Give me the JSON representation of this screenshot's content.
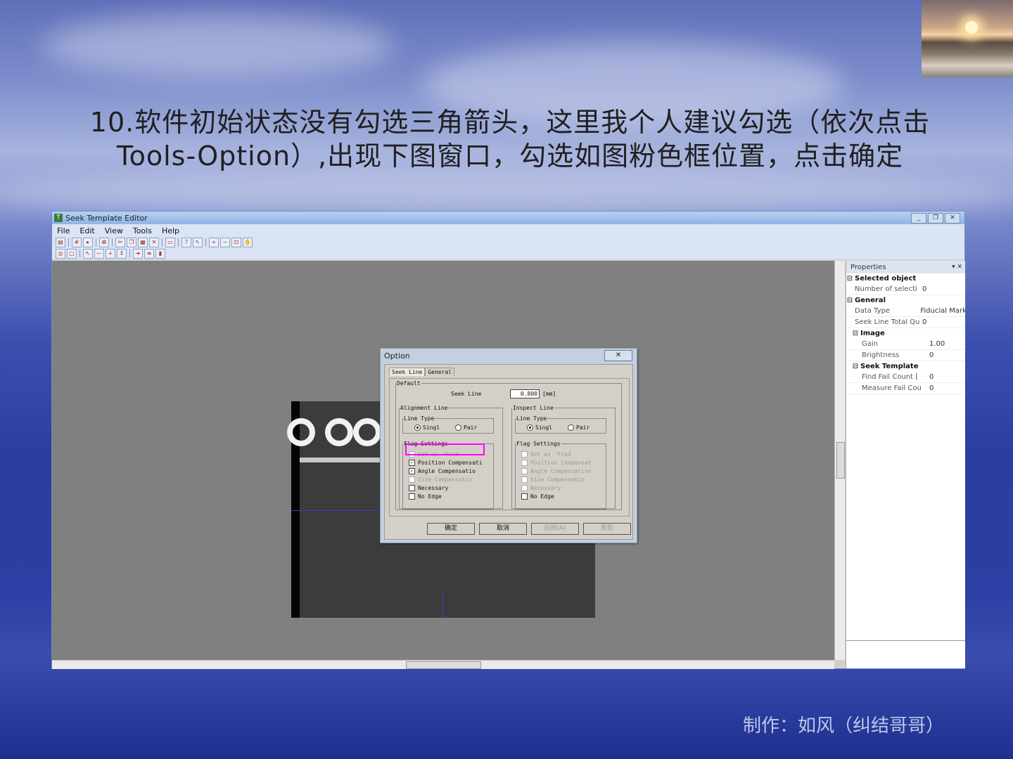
{
  "slide": {
    "title_line1": "10.软件初始状态没有勾选三角箭头，这里我个人建议勾选（依次点击",
    "title_line2": "Tools-Option）,出现下图窗口，勾选如图粉色框位置，点击确定",
    "credit": "制作：如风（纠结哥哥）"
  },
  "app": {
    "window_title": "Seek Template Editor",
    "menu": [
      "File",
      "Edit",
      "View",
      "Tools",
      "Help"
    ],
    "win_buttons": [
      "_",
      "❐",
      "✕"
    ]
  },
  "properties": {
    "header": "Properties",
    "pin": "▾ ✕",
    "categories": [
      {
        "name": "Selected object",
        "rows": [
          {
            "k": "Number of selecti",
            "v": "0"
          }
        ]
      },
      {
        "name": "General",
        "rows": [
          {
            "k": "Data Type",
            "v": "Fiducial Mark"
          },
          {
            "k": "Seek Line Total Qu",
            "v": "0"
          }
        ]
      },
      {
        "name": "Image",
        "rows": [
          {
            "k": "Gain",
            "v": "1.00"
          },
          {
            "k": "Brightness",
            "v": "0"
          }
        ]
      },
      {
        "name": "Seek Template",
        "rows": [
          {
            "k": "Find Fail Count [",
            "v": "0"
          },
          {
            "k": "Measure Fail Cou",
            "v": "0"
          }
        ]
      }
    ]
  },
  "dialog": {
    "title": "Option",
    "close": "✕",
    "tabs": [
      "Seek Line",
      "General"
    ],
    "default_group": "Default",
    "seek_line_label": "Seek Line",
    "seek_line_value": "0.800",
    "seek_line_unit": "[mm]",
    "alignment_group": "Alignment Line",
    "inspect_group": "Inspect Line",
    "line_type_group": "Line Type",
    "radio_single": "Singl",
    "radio_pair": "Pair",
    "flag_settings_group": "Flag Settings",
    "alignment_flags": [
      {
        "label": "Set as 'Find",
        "checked": false,
        "enabled": false
      },
      {
        "label": "Position Compensati",
        "checked": true,
        "enabled": true
      },
      {
        "label": "Angle Compensatio",
        "checked": true,
        "enabled": true
      },
      {
        "label": "Size Compensatio",
        "checked": false,
        "enabled": false
      },
      {
        "label": "Necessary",
        "checked": false,
        "enabled": true
      },
      {
        "label": "No Edge",
        "checked": false,
        "enabled": true
      }
    ],
    "inspect_flags": [
      {
        "label": "Set as 'Find",
        "checked": false,
        "enabled": false
      },
      {
        "label": "Position Compensat",
        "checked": false,
        "enabled": false
      },
      {
        "label": "Angle Compensation",
        "checked": false,
        "enabled": false
      },
      {
        "label": "Size Compensatio",
        "checked": false,
        "enabled": false
      },
      {
        "label": "Necessary",
        "checked": false,
        "enabled": false
      },
      {
        "label": "No Edge",
        "checked": false,
        "enabled": true
      }
    ],
    "buttons": {
      "ok": "确定",
      "cancel": "取消",
      "apply": "应用(A)",
      "help": "帮助"
    }
  },
  "colors": {
    "highlight": "#ff00ff",
    "workspace": "#808080"
  }
}
